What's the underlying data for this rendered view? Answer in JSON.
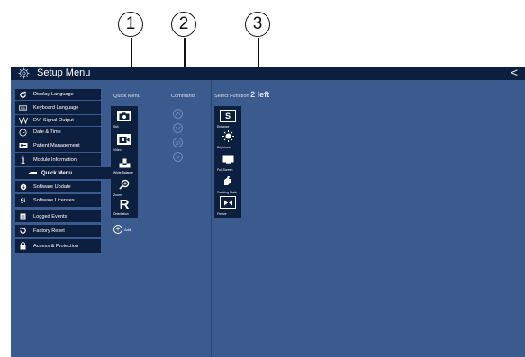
{
  "callouts": [
    "1",
    "2",
    "3"
  ],
  "window": {
    "title": "Setup Menu",
    "back_glyph": "<"
  },
  "sidebar": {
    "items": [
      {
        "label": "Display Language",
        "icon": "rotate-icon"
      },
      {
        "label": "Keyboard Language",
        "icon": "keyboard-icon"
      },
      {
        "label": "DVI Signal Output",
        "icon": "signal-icon"
      },
      {
        "label": "Date & Time",
        "icon": "clock-icon"
      },
      {
        "label": "Patient Management",
        "icon": "patient-icon"
      },
      {
        "label": "Module Information",
        "icon": "info-icon"
      },
      {
        "label": "Quick Menu",
        "icon": "quick-menu-icon",
        "active": true
      },
      {
        "label": "Software Update",
        "icon": "update-icon"
      },
      {
        "label": "Software Licenses",
        "icon": "license-icon"
      },
      {
        "label": "Logged Events",
        "icon": "events-icon"
      },
      {
        "label": "Factory Reset",
        "icon": "reset-icon"
      },
      {
        "label": "Access & Protection",
        "icon": "lock-icon"
      }
    ]
  },
  "quick_menu": {
    "header": "Quick Menu",
    "items": [
      {
        "label": "Still",
        "icon": "camera-icon"
      },
      {
        "label": "Video",
        "icon": "video-icon"
      },
      {
        "label": "White Balance",
        "icon": "white-balance-icon"
      },
      {
        "label": "Zoom",
        "icon": "zoom-icon"
      },
      {
        "label": "Orientation",
        "icon": "orientation-icon"
      }
    ],
    "add_label": "Add"
  },
  "command": {
    "header": "Command",
    "buttons": [
      "move-up-icon",
      "move-down-icon",
      "replace-icon",
      "remove-icon"
    ]
  },
  "select_function": {
    "header": "Select Function",
    "remaining": "2 left",
    "items": [
      {
        "label": "Enhance",
        "icon": "enhance-icon"
      },
      {
        "label": "Brightness",
        "icon": "brightness-icon"
      },
      {
        "label": "Full-Screen",
        "icon": "fullscreen-icon"
      },
      {
        "label": "Tracking Mode",
        "icon": "tracking-icon"
      },
      {
        "label": "Freeze",
        "icon": "freeze-icon"
      }
    ]
  },
  "colors": {
    "panel": "#3b5a8e",
    "dark": "#0c1f3f",
    "header_text": "#d6e1f2"
  }
}
